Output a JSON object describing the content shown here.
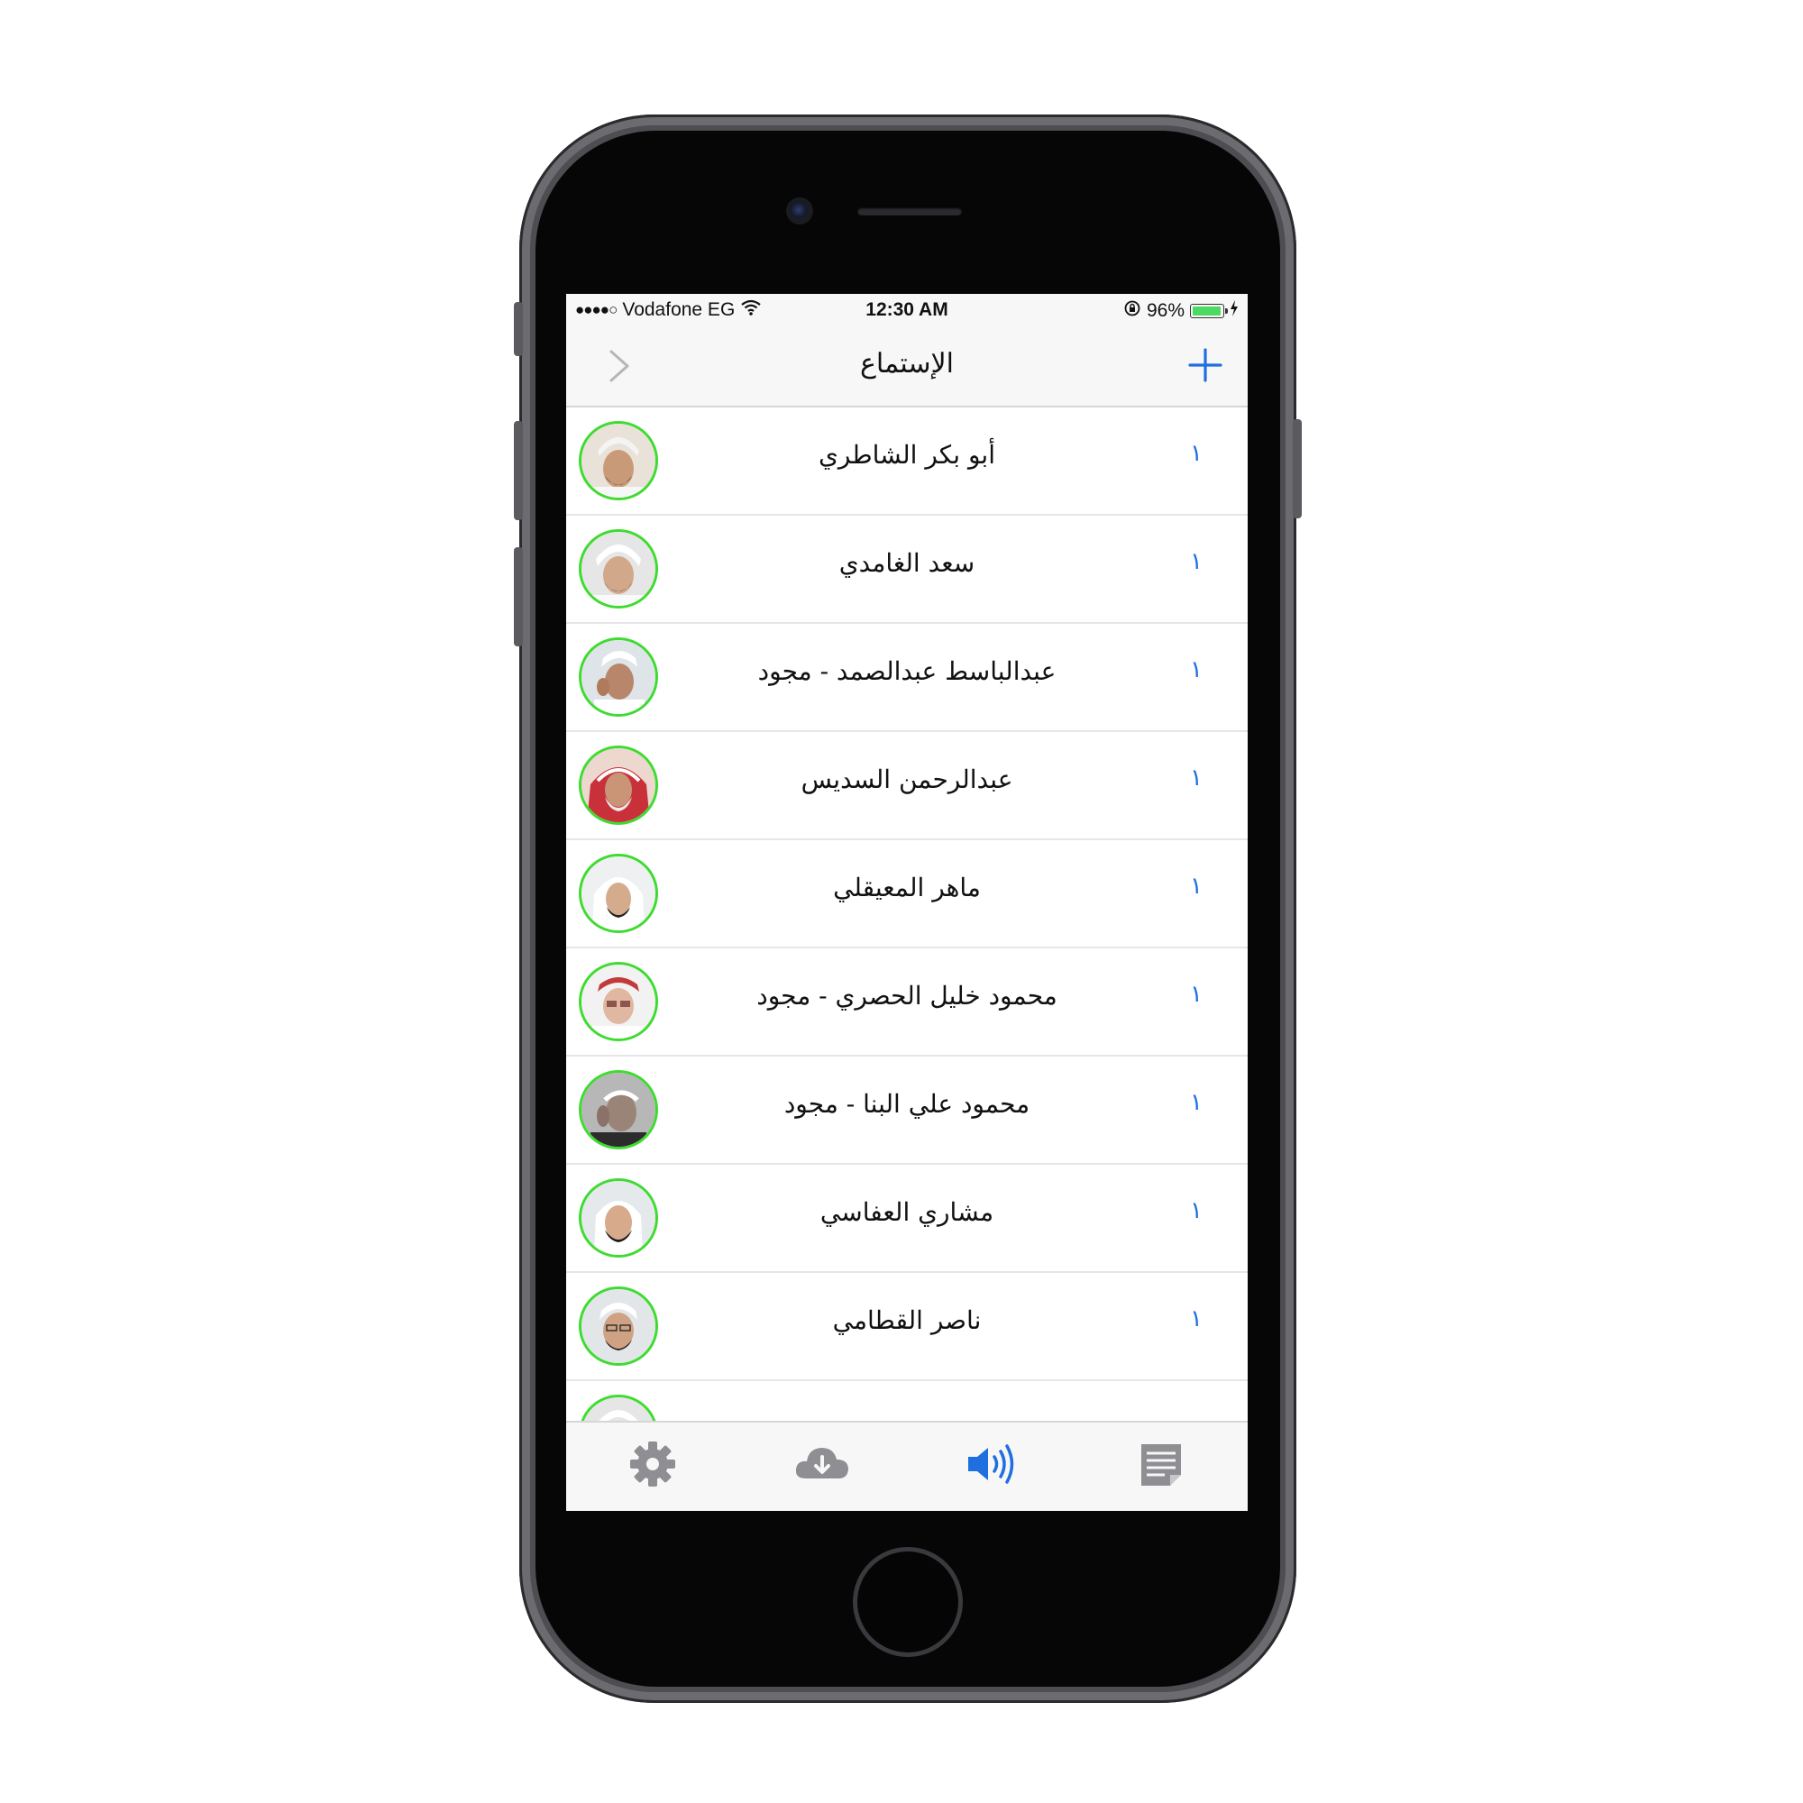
{
  "status_bar": {
    "signal": "●●●●○",
    "carrier": "Vodafone EG",
    "time": "12:30 AM",
    "battery_percent": "96%",
    "battery_level": 0.96,
    "icons": [
      "wifi-icon",
      "orientation-lock-icon",
      "battery-icon",
      "charging-icon"
    ]
  },
  "nav": {
    "title": "الإستماع",
    "back_icon": "chevron-right-icon",
    "add_icon": "plus-icon"
  },
  "colors": {
    "accent": "#1f6fe0",
    "avatar_ring": "#3ddc2f",
    "inactive_tab": "#8e8e93"
  },
  "reciters": [
    {
      "name": "أبو بكر الشاطري",
      "count": "١"
    },
    {
      "name": "سعد الغامدي",
      "count": "١"
    },
    {
      "name": "عبدالباسط عبدالصمد - مجود",
      "count": "١"
    },
    {
      "name": "عبدالرحمن السديس",
      "count": "١"
    },
    {
      "name": "ماهر المعيقلي",
      "count": "١"
    },
    {
      "name": "محمود خليل الحصري - مجود",
      "count": "١"
    },
    {
      "name": "محمود علي البنا - مجود",
      "count": "١"
    },
    {
      "name": "مشاري العفاسي",
      "count": "١"
    },
    {
      "name": "ناصر القطامي",
      "count": "١"
    }
  ],
  "tabs": [
    {
      "icon": "gear-icon",
      "active": false
    },
    {
      "icon": "cloud-download-icon",
      "active": false
    },
    {
      "icon": "speaker-icon",
      "active": true
    },
    {
      "icon": "notes-icon",
      "active": false
    }
  ]
}
